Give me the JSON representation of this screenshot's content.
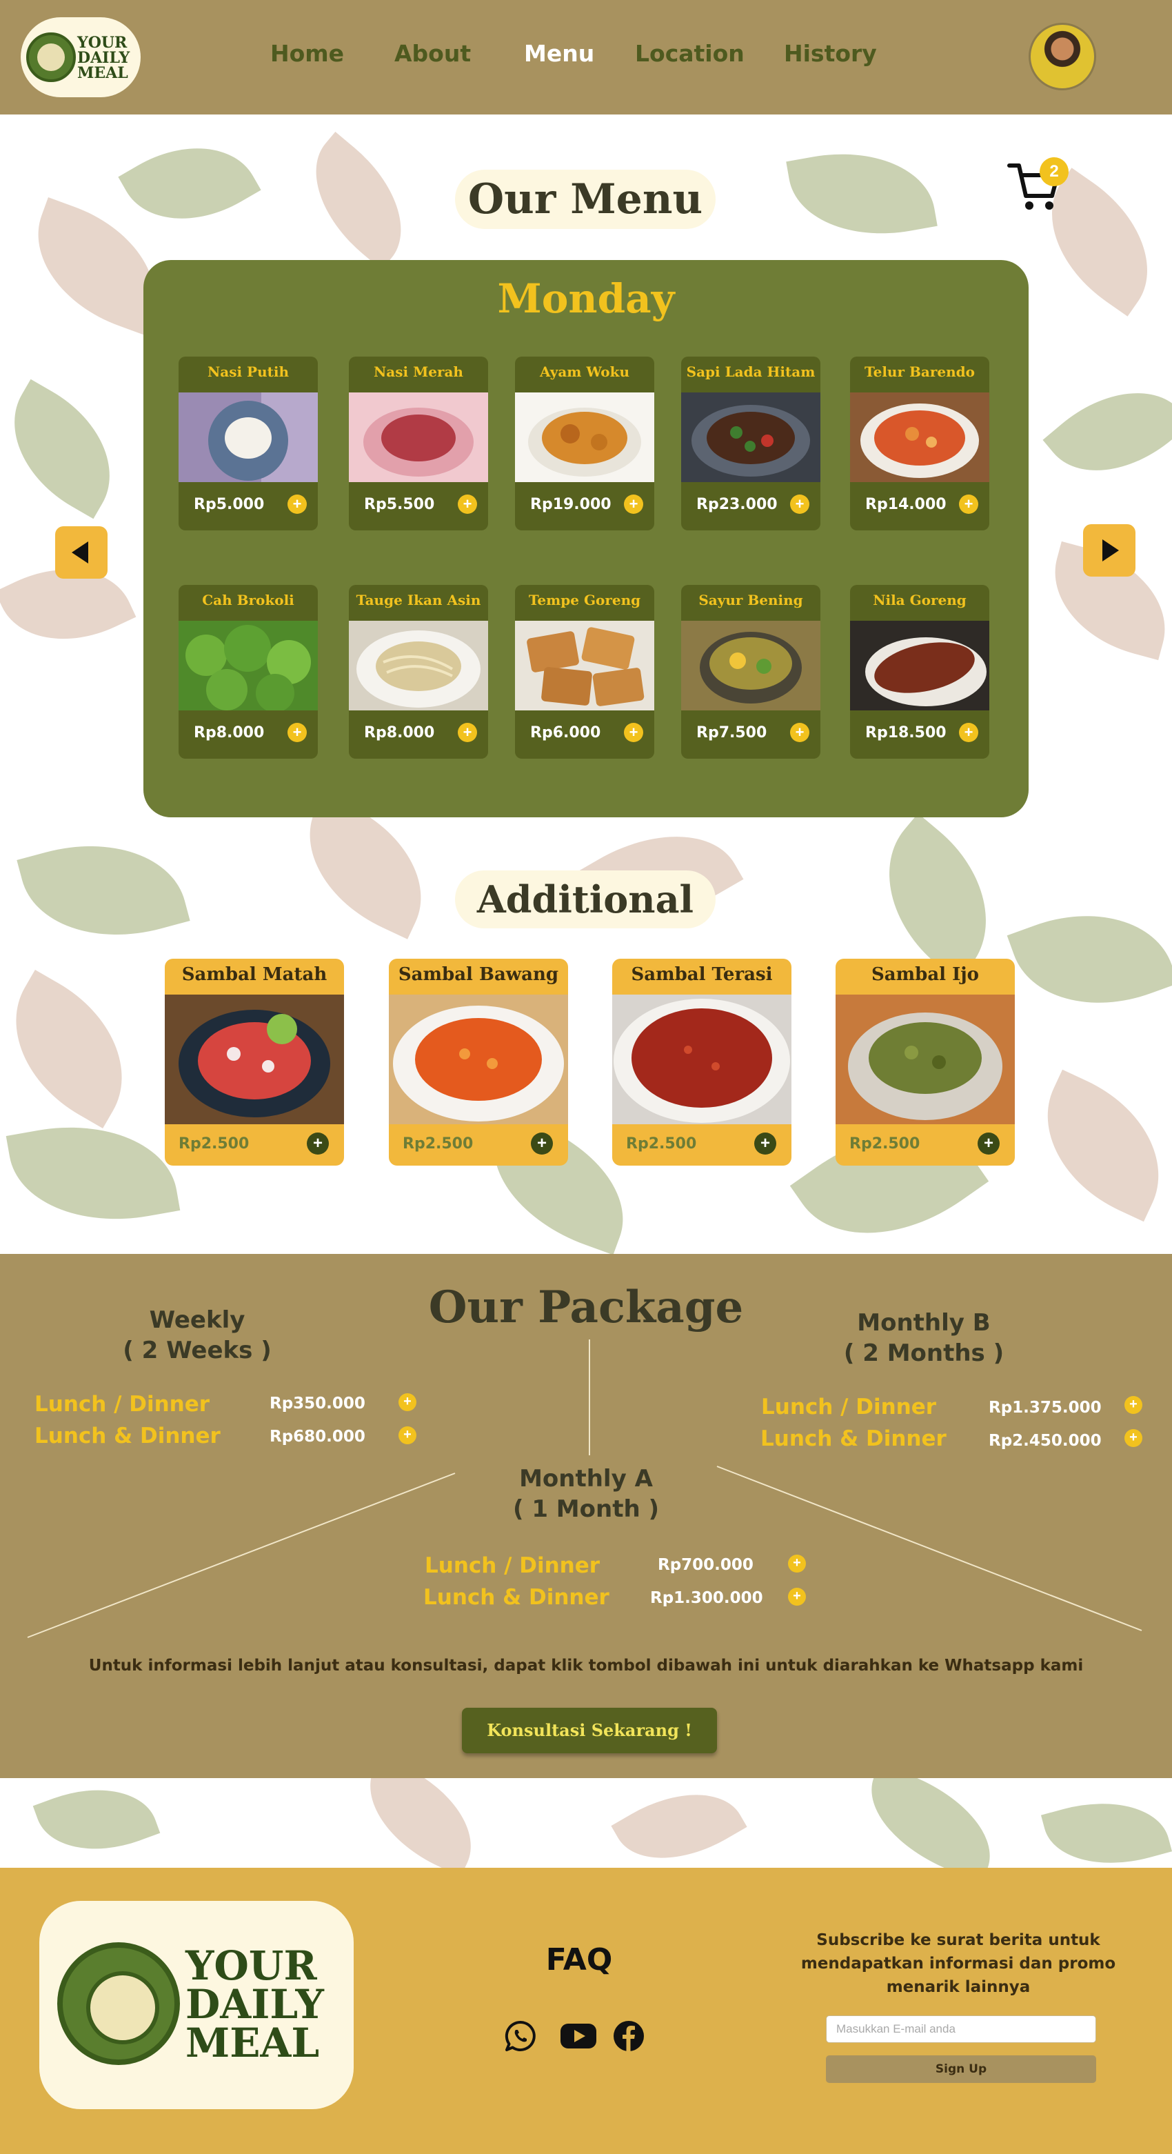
{
  "brand": {
    "logo_text": [
      "YOUR",
      "DAILY",
      "MEAL"
    ]
  },
  "nav": {
    "items": [
      {
        "label": "Home",
        "active": false
      },
      {
        "label": "About",
        "active": false
      },
      {
        "label": "Menu",
        "active": true
      },
      {
        "label": "Location",
        "active": false
      },
      {
        "label": "History",
        "active": false
      }
    ]
  },
  "menu": {
    "title": "Our Menu",
    "cart_count": "2",
    "day": "Monday",
    "items": [
      {
        "name": "Nasi Putih",
        "price": "Rp5.000"
      },
      {
        "name": "Nasi Merah",
        "price": "Rp5.500"
      },
      {
        "name": "Ayam Woku",
        "price": "Rp19.000"
      },
      {
        "name": "Sapi Lada Hitam",
        "price": "Rp23.000"
      },
      {
        "name": "Telur Barendo",
        "price": "Rp14.000"
      },
      {
        "name": "Cah Brokoli",
        "price": "Rp8.000"
      },
      {
        "name": "Tauge Ikan Asin",
        "price": "Rp8.000"
      },
      {
        "name": "Tempe Goreng",
        "price": "Rp6.000"
      },
      {
        "name": "Sayur Bening",
        "price": "Rp7.500"
      },
      {
        "name": "Nila Goreng",
        "price": "Rp18.500"
      }
    ]
  },
  "additional": {
    "title": "Additional",
    "items": [
      {
        "name": "Sambal Matah",
        "price": "Rp2.500"
      },
      {
        "name": "Sambal Bawang",
        "price": "Rp2.500"
      },
      {
        "name": "Sambal Terasi",
        "price": "Rp2.500"
      },
      {
        "name": "Sambal Ijo",
        "price": "Rp2.500"
      }
    ]
  },
  "package": {
    "title": "Our Package",
    "weekly": {
      "title": "Weekly",
      "subtitle": "( 2 Weeks )",
      "options": [
        {
          "label": "Lunch / Dinner",
          "price": "Rp350.000"
        },
        {
          "label": "Lunch & Dinner",
          "price": "Rp680.000"
        }
      ]
    },
    "monthly_b": {
      "title": "Monthly B",
      "subtitle": "( 2 Months )",
      "options": [
        {
          "label": "Lunch / Dinner",
          "price": "Rp1.375.000"
        },
        {
          "label": "Lunch & Dinner",
          "price": "Rp2.450.000"
        }
      ]
    },
    "monthly_a": {
      "title": "Monthly A",
      "subtitle": "( 1 Month )",
      "options": [
        {
          "label": "Lunch / Dinner",
          "price": "Rp700.000"
        },
        {
          "label": "Lunch & Dinner",
          "price": "Rp1.300.000"
        }
      ]
    },
    "info": "Untuk informasi lebih lanjut atau konsultasi, dapat klik tombol dibawah ini untuk diarahkan ke Whatsapp kami",
    "cta": "Konsultasi Sekarang !"
  },
  "footer": {
    "faq": "FAQ",
    "social_icons": [
      "whatsapp-icon",
      "youtube-icon",
      "facebook-icon"
    ],
    "subscribe_text": "Subscribe ke surat berita untuk mendapatkan informasi dan promo menarik lainnya",
    "email_placeholder": "Masukkan E-mail anda",
    "signup_label": "Sign Up"
  },
  "colors": {
    "header_bg": "#a8925f",
    "menu_panel": "#6f7d36",
    "accent_yellow": "#f2c21e",
    "footer_bg": "#ddb14c"
  }
}
